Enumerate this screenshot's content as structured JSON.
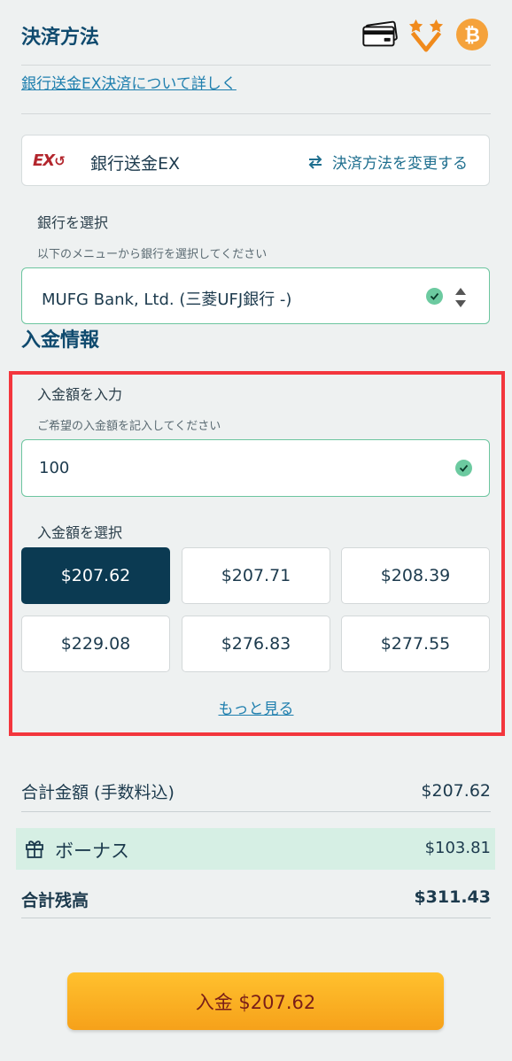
{
  "header": {
    "title": "決済方法",
    "icons": [
      "credit-card-icon",
      "stars-badge-icon",
      "bitcoin-icon"
    ],
    "bitcoin_symbol": "₿"
  },
  "info_link": "銀行送金EX決済について詳しく",
  "method": {
    "logo_text": "EX",
    "name": "銀行送金EX",
    "change_label": "決済方法を変更する"
  },
  "bank": {
    "label": "銀行を選択",
    "hint": "以下のメニューから銀行を選択してください",
    "selected": "MUFG Bank, Ltd. (三菱UFJ銀行 -)"
  },
  "deposit_section": {
    "title": "入金情報",
    "input_label": "入金額を入力",
    "input_hint": "ご希望の入金額を記入してください",
    "input_value": "100",
    "choose_label": "入金額を選択",
    "amounts": [
      "$207.62",
      "$207.71",
      "$208.39",
      "$229.08",
      "$276.83",
      "$277.55"
    ],
    "selected_index": 0,
    "more_label": "もっと見る"
  },
  "summary": {
    "total_label": "合計金額 (手数料込)",
    "total_value": "$207.62",
    "bonus_label": "ボーナス",
    "bonus_value": "$103.81",
    "balance_label": "合計残高",
    "balance_value": "$311.43"
  },
  "cta": {
    "label": "入金 $207.62"
  },
  "colors": {
    "accent": "#0f4a6e",
    "selected_amount_bg": "#0b3a52",
    "success": "#6ccaa0",
    "highlight": "#f3363d",
    "bonus_bg": "#d6efe4",
    "cta": "#f6a11a"
  }
}
